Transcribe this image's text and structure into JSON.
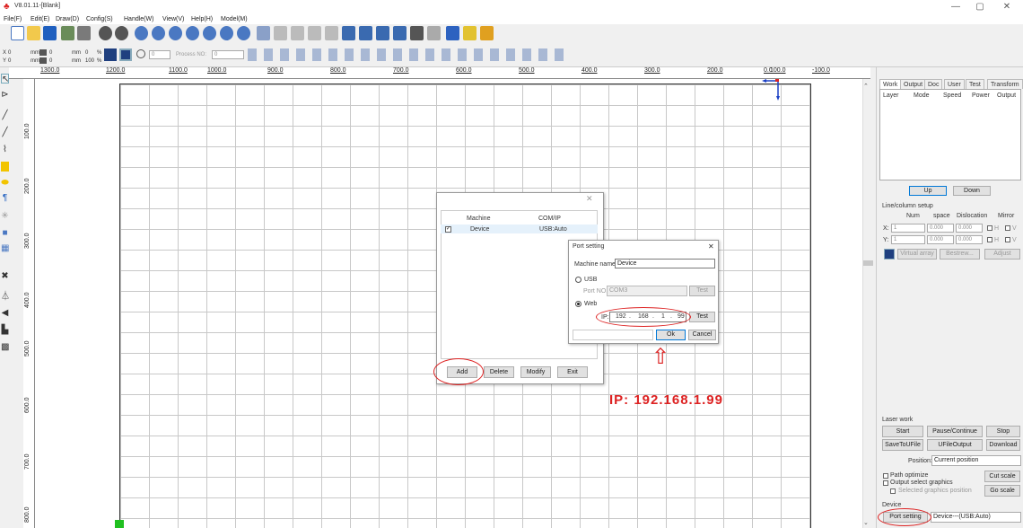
{
  "window": {
    "title": "V8.01.11-[Blank]",
    "min": "—",
    "max": "▢",
    "close": "✕"
  },
  "menu": [
    "File(F)",
    "Edit(E)",
    "Draw(D)",
    "Config(S)",
    "Handle(W)",
    "View(V)",
    "Help(H)",
    "Model(M)"
  ],
  "toolbar2": {
    "x_label": "X",
    "x_val": "0",
    "y_label": "Y",
    "y_val": "0",
    "mm1": "mm",
    "mm2": "mm",
    "mm3": "mm",
    "mm4": "mm",
    "w_val": "0",
    "h_val": "0",
    "pct1": "%",
    "pct2": "%",
    "p0": "0",
    "p100a": "100",
    "rot_val": "0",
    "process_label": "Process NO:",
    "process_val": "0",
    "p0b": "0",
    "p0c": "0"
  },
  "ruler_h": [
    "1300.0",
    "1200.0",
    "1100.0",
    "1000.0",
    "900.0",
    "800.0",
    "700.0",
    "600.0",
    "500.0",
    "400.0",
    "300.0",
    "200.0",
    "100.0",
    "0.0",
    "-100.0"
  ],
  "ruler_v": [
    "100.0",
    "200.0",
    "300.0",
    "400.0",
    "500.0",
    "600.0",
    "700.0",
    "800.0"
  ],
  "right": {
    "tabs": [
      "Work",
      "Output",
      "Doc",
      "User",
      "Test",
      "Transform"
    ],
    "layer_cols": [
      "Layer",
      "Mode",
      "Speed",
      "Power",
      "Output"
    ],
    "up": "Up",
    "down": "Down",
    "linecol_title": "Line/column setup",
    "lc_cols": [
      "Num",
      "space",
      "Dislocation",
      "Mirror"
    ],
    "x_label": "X:",
    "y_label": "Y:",
    "x_num": "1",
    "x_space": "0.000",
    "x_disl": "0.000",
    "y_num": "1",
    "y_space": "0.000",
    "y_disl": "0.000",
    "h": "H",
    "v": "V",
    "virtual_array": "Virtual array",
    "bestrew": "Bestrew...",
    "adjust": "Adjust",
    "laser_work": "Laser work",
    "start": "Start",
    "pause": "Pause/Continue",
    "stop": "Stop",
    "save_ufile": "SaveToUFile",
    "ufile_output": "UFileOutput",
    "download": "Download",
    "position_label": "Position:",
    "position_val": "Current position",
    "path_optimize": "Path optimize",
    "output_select": "Output select graphics",
    "selected_pos": "Selected graphics position",
    "cut_scale": "Cut scale",
    "go_scale": "Go scale",
    "device_label": "Device",
    "port_setting": "Port setting",
    "device_val": "Device---(USB:Auto)"
  },
  "machine_dialog": {
    "close": "✕",
    "col_machine": "Machine",
    "col_com": "COM/IP",
    "row_name": "Device",
    "row_com": "USB:Auto",
    "add": "Add",
    "delete": "Delete",
    "modify": "Modify",
    "exit": "Exit"
  },
  "port_dialog": {
    "title": "Port setting",
    "close": "✕",
    "machine_name_label": "Machine name:",
    "machine_name": "Device",
    "usb": "USB",
    "port_no_label": "Port NO.:",
    "port_no": "COM3",
    "test1": "Test",
    "web": "Web",
    "ip_label": "IP:",
    "ip1": "192",
    "ip2": "168",
    "ip3": "1",
    "ip4": "99",
    "test2": "Test",
    "ok": "Ok",
    "cancel": "Cancel"
  },
  "annotation": {
    "ip_text": "IP:   192.168.1.99",
    "arrow": "⇧"
  }
}
